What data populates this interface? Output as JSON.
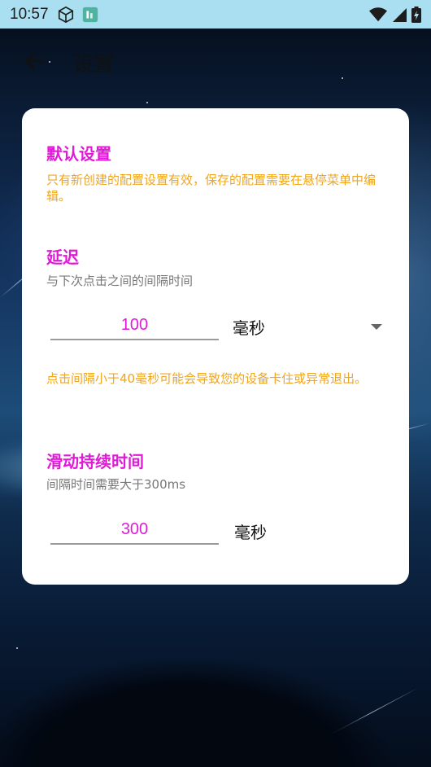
{
  "status_bar": {
    "time": "10:57",
    "icons": [
      "cube-icon",
      "app-notification-icon",
      "wifi-icon",
      "signal-icon",
      "battery-charging-icon"
    ]
  },
  "app_bar": {
    "back_icon": "arrow-left-icon",
    "title": "设置"
  },
  "default_settings": {
    "title": "默认设置",
    "description": "只有新创建的配置设置有效，保存的配置需要在悬停菜单中编辑。"
  },
  "delay": {
    "title": "延迟",
    "subtitle": "与下次点击之间的间隔时间",
    "value": "100",
    "unit": "毫秒",
    "warning": "点击间隔小于40毫秒可能会导致您的设备卡住或异常退出。"
  },
  "swipe_duration": {
    "title": "滑动持续时间",
    "subtitle": "间隔时间需要大于300ms",
    "value": "300",
    "unit": "毫秒"
  },
  "colors": {
    "accent": "#e01bd7",
    "hint": "#f0a51c",
    "status_bar": "#a9dff0"
  }
}
